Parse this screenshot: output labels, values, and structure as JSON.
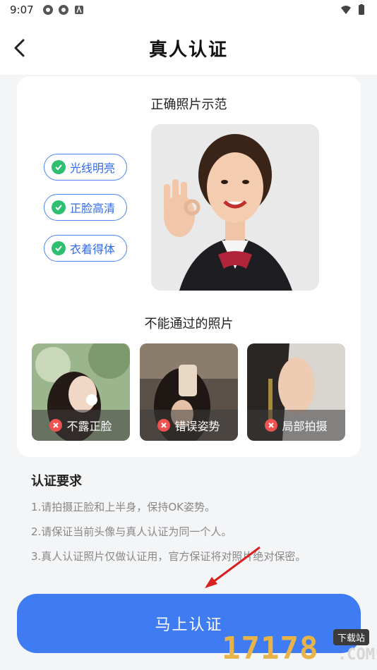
{
  "status_bar": {
    "time": "9:07"
  },
  "header": {
    "title": "真人认证"
  },
  "card": {
    "correct_title": "正确照片示范",
    "chips": [
      "光线明亮",
      "正脸高清",
      "衣着得体"
    ],
    "wrong_title": "不能通过的照片",
    "bad_photos": [
      {
        "label": "不露正脸"
      },
      {
        "label": "错误姿势"
      },
      {
        "label": "局部拍摄"
      }
    ]
  },
  "requirements": {
    "title": "认证要求",
    "items": [
      "1.请拍摄正脸和上半身，保持OK姿势。",
      "2.请保证当前头像与真人认证为同一个人。",
      "3.真人认证照片仅做认证用，官方保证将对照片绝对保密。"
    ]
  },
  "cta": {
    "label": "马上认证"
  },
  "watermark": {
    "number": "17178",
    "tag": "下载站",
    "domain": ".COM"
  },
  "colors": {
    "accent": "#3f7cf3",
    "ok": "#2fbf71",
    "error": "#f05252"
  }
}
